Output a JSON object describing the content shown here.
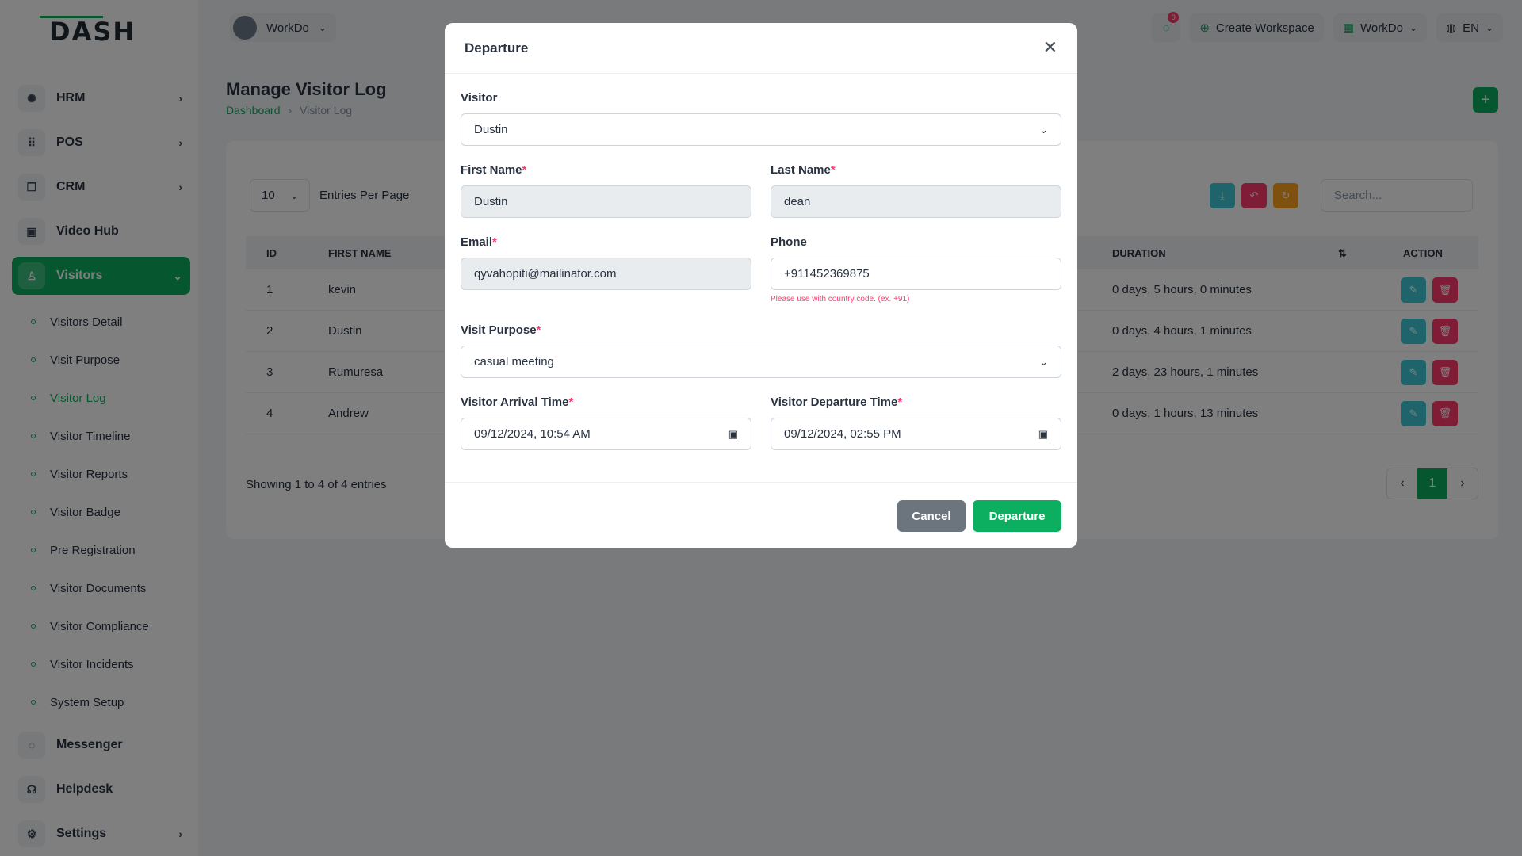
{
  "brand": {
    "logo_text": "DASH"
  },
  "sidebar": {
    "items": [
      {
        "label": "HRM",
        "icon": "hrm-icon",
        "chevron": "›"
      },
      {
        "label": "POS",
        "icon": "grid-icon",
        "chevron": "›"
      },
      {
        "label": "CRM",
        "icon": "crm-icon",
        "chevron": "›"
      },
      {
        "label": "Video Hub",
        "icon": "video-icon",
        "chevron": ""
      },
      {
        "label": "Visitors",
        "icon": "visitor-icon",
        "chevron": "⌄",
        "active": true
      }
    ],
    "sub_items": [
      "Visitors Detail",
      "Visit Purpose",
      "Visitor Log",
      "Visitor Timeline",
      "Visitor Reports",
      "Visitor Badge",
      "Pre Registration",
      "Visitor Documents",
      "Visitor Compliance",
      "Visitor Incidents",
      "System Setup"
    ],
    "active_sub": "Visitor Log",
    "bottom_items": [
      {
        "label": "Messenger",
        "icon": "chat-icon"
      },
      {
        "label": "Helpdesk",
        "icon": "headset-icon"
      },
      {
        "label": "Settings",
        "icon": "gear-icon",
        "chevron": "›"
      }
    ]
  },
  "topbar": {
    "workspace": "WorkDo",
    "notification_count": "0",
    "create_workspace": "Create Workspace",
    "workspace_menu": "WorkDo",
    "language": "EN"
  },
  "page": {
    "title": "Manage Visitor Log",
    "breadcrumb": [
      "Dashboard",
      "Visitor Log"
    ]
  },
  "table": {
    "entries_value": "10",
    "entries_label": "Entries Per Page",
    "search_placeholder": "Search...",
    "headers": {
      "id": "ID",
      "first_name": "FIRST NAME",
      "duration": "DURATION",
      "action": "ACTION"
    },
    "rows": [
      {
        "id": "1",
        "first_name": "kevin",
        "duration": "0 days, 5 hours, 0 minutes"
      },
      {
        "id": "2",
        "first_name": "Dustin",
        "duration": "0 days, 4 hours, 1 minutes"
      },
      {
        "id": "3",
        "first_name": "Rumuresa",
        "duration": "2 days, 23 hours, 1 minutes"
      },
      {
        "id": "4",
        "first_name": "Andrew",
        "duration": "0 days, 1 hours, 13 minutes"
      }
    ],
    "showing": "Showing 1 to 4 of 4 entries",
    "current_page": "1"
  },
  "modal": {
    "title": "Departure",
    "visitor_label": "Visitor",
    "visitor_value": "Dustin",
    "first_name_label": "First Name",
    "first_name_value": "Dustin",
    "last_name_label": "Last Name",
    "last_name_value": "dean",
    "email_label": "Email",
    "email_value": "qyvahopiti@mailinator.com",
    "phone_label": "Phone",
    "phone_value": "+911452369875",
    "phone_hint": "Please use with country code. (ex. +91)",
    "purpose_label": "Visit Purpose",
    "purpose_value": "casual meeting",
    "arrival_label": "Visitor Arrival Time",
    "arrival_value": "09/12/2024, 10:54 AM",
    "departure_label": "Visitor Departure Time",
    "departure_value": "09/12/2024, 02:55 PM",
    "cancel_label": "Cancel",
    "submit_label": "Departure",
    "required_mark": "*"
  },
  "colors": {
    "primary": "#0caf60",
    "danger": "#ff3a6e",
    "info": "#3ec9d6",
    "warning": "#ffa21d"
  }
}
